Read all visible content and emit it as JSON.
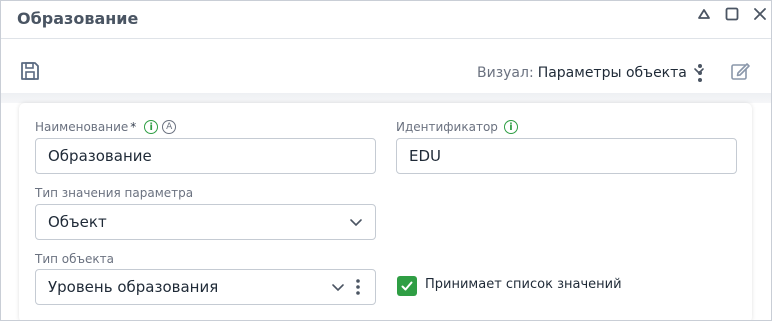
{
  "window": {
    "title": "Образование"
  },
  "toolbar": {
    "visual_label": "Визуал:",
    "visual_value": "Параметры объекта"
  },
  "form": {
    "name": {
      "label": "Наименование",
      "required_mark": "*",
      "value": "Образование"
    },
    "identifier": {
      "label": "Идентификатор",
      "value": "EDU"
    },
    "param_type": {
      "label": "Тип значения параметра",
      "value": "Объект"
    },
    "object_type": {
      "label": "Тип объекта",
      "value": "Уровень образования"
    },
    "accepts_list": {
      "label": "Принимает список значений",
      "checked": true
    }
  },
  "icons": {
    "info": "i",
    "autotranslate": "A"
  },
  "colors": {
    "accent_green": "#2f9e44",
    "title_gray": "#4a5563",
    "icon_blue_gray": "#5b6b82"
  }
}
